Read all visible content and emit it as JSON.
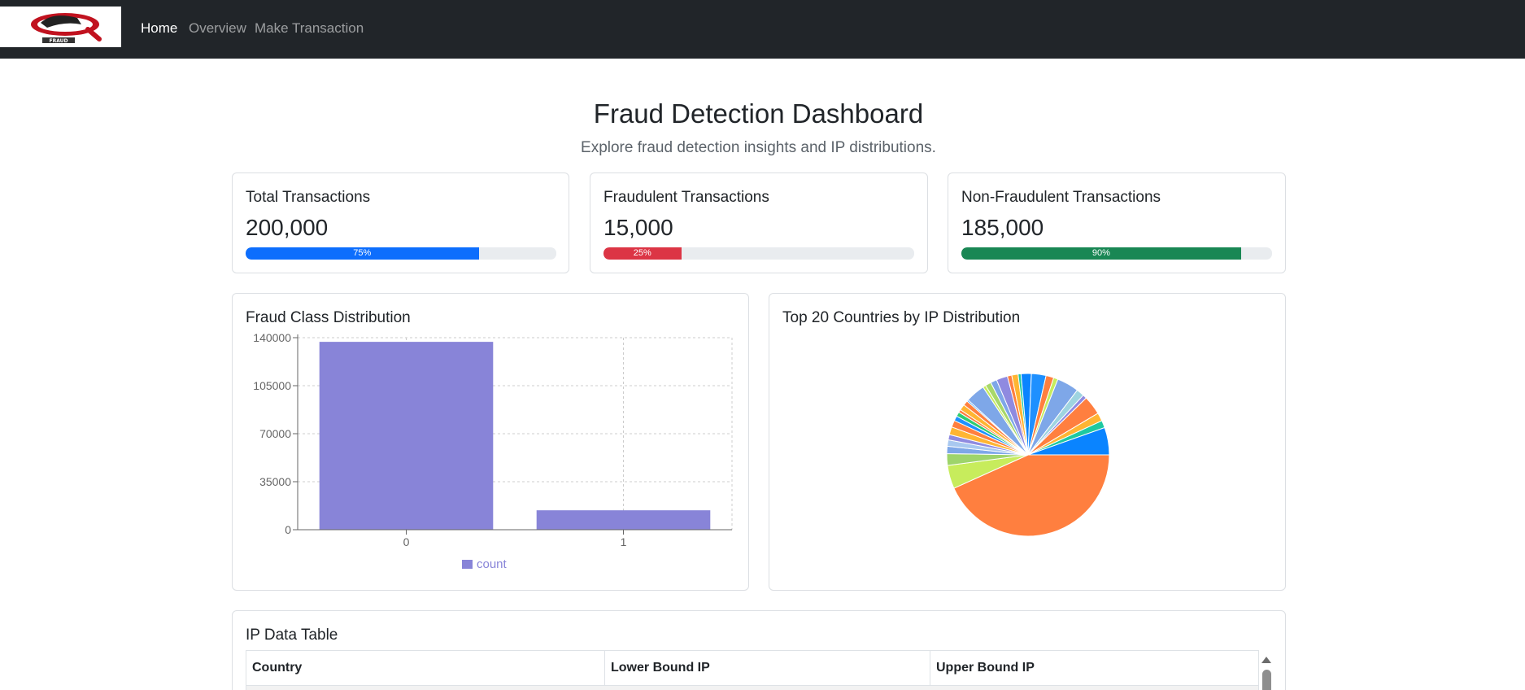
{
  "navbar": {
    "brand_alt": "logo",
    "brand_text": "FRAUD",
    "links": [
      "Home",
      "Overview",
      "Make Transaction"
    ]
  },
  "header": {
    "title": "Fraud Detection Dashboard",
    "subtitle": "Explore fraud detection insights and IP distributions."
  },
  "stats": [
    {
      "title": "Total Transactions",
      "value": "200,000",
      "progress": 75,
      "progress_label": "75%",
      "color": "#0d6efd"
    },
    {
      "title": "Fraudulent Transactions",
      "value": "15,000",
      "progress": 25,
      "progress_label": "25%",
      "color": "#dc3545"
    },
    {
      "title": "Non-Fraudulent Transactions",
      "value": "185,000",
      "progress": 90,
      "progress_label": "90%",
      "color": "#198754"
    }
  ],
  "fraud_chart": {
    "title": "Fraud Class Distribution"
  },
  "pie_chart": {
    "title": "Top 20 Countries by IP Distribution"
  },
  "chart_data": [
    {
      "type": "bar",
      "title": "Fraud Class Distribution",
      "categories": [
        "0",
        "1"
      ],
      "series": [
        {
          "name": "count",
          "values": [
            136961,
            14151
          ],
          "color": "#8884d8"
        }
      ],
      "ylim": [
        0,
        140000
      ],
      "yticks": [
        "0",
        "35000",
        "70000",
        "105000",
        "140000"
      ],
      "grid": true,
      "legend": "bottom"
    },
    {
      "type": "pie",
      "title": "Top 20 Countries by IP Distribution",
      "values": [
        44.6,
        4.8,
        2.4,
        1.5,
        1.3,
        1.1,
        1.6,
        1.4,
        1.0,
        0.9,
        0.6,
        1.2,
        1.0,
        0.3,
        4.0,
        0.6,
        1.2,
        1.3,
        2.3,
        0.9,
        1.3,
        0.6,
        2.1,
        3.0,
        1.6,
        0.9,
        4.5,
        1.6,
        0.8,
        3.9,
        1.7,
        1.5,
        5.6
      ],
      "colors": [
        "#ff7f3f",
        "#c7ec5c",
        "#9ed46b",
        "#7ea7e8",
        "#a8c8f0",
        "#8f8ae0",
        "#ffb532",
        "#ff7f3f",
        "#1e90ff",
        "#2ecc71",
        "#ff7f3f",
        "#ffb532",
        "#ff7f3f",
        "#1e90ff",
        "#7ea7e8",
        "#c7ec5c",
        "#a8d86a",
        "#7ea7e8",
        "#8f8ae0",
        "#ff7f3f",
        "#ffb532",
        "#1ec9a0",
        "#0a84ff",
        "#1e90ff",
        "#ff7f3f",
        "#c7ec5c",
        "#7ea7e8",
        "#9ed4e0",
        "#8f8ae0",
        "#ff7f3f",
        "#ffb532",
        "#1ec9a0",
        "#0a84ff"
      ],
      "legend": "none"
    }
  ],
  "ip_table": {
    "title": "IP Data Table",
    "columns": [
      "Country",
      "Lower Bound IP",
      "Upper Bound IP"
    ]
  }
}
